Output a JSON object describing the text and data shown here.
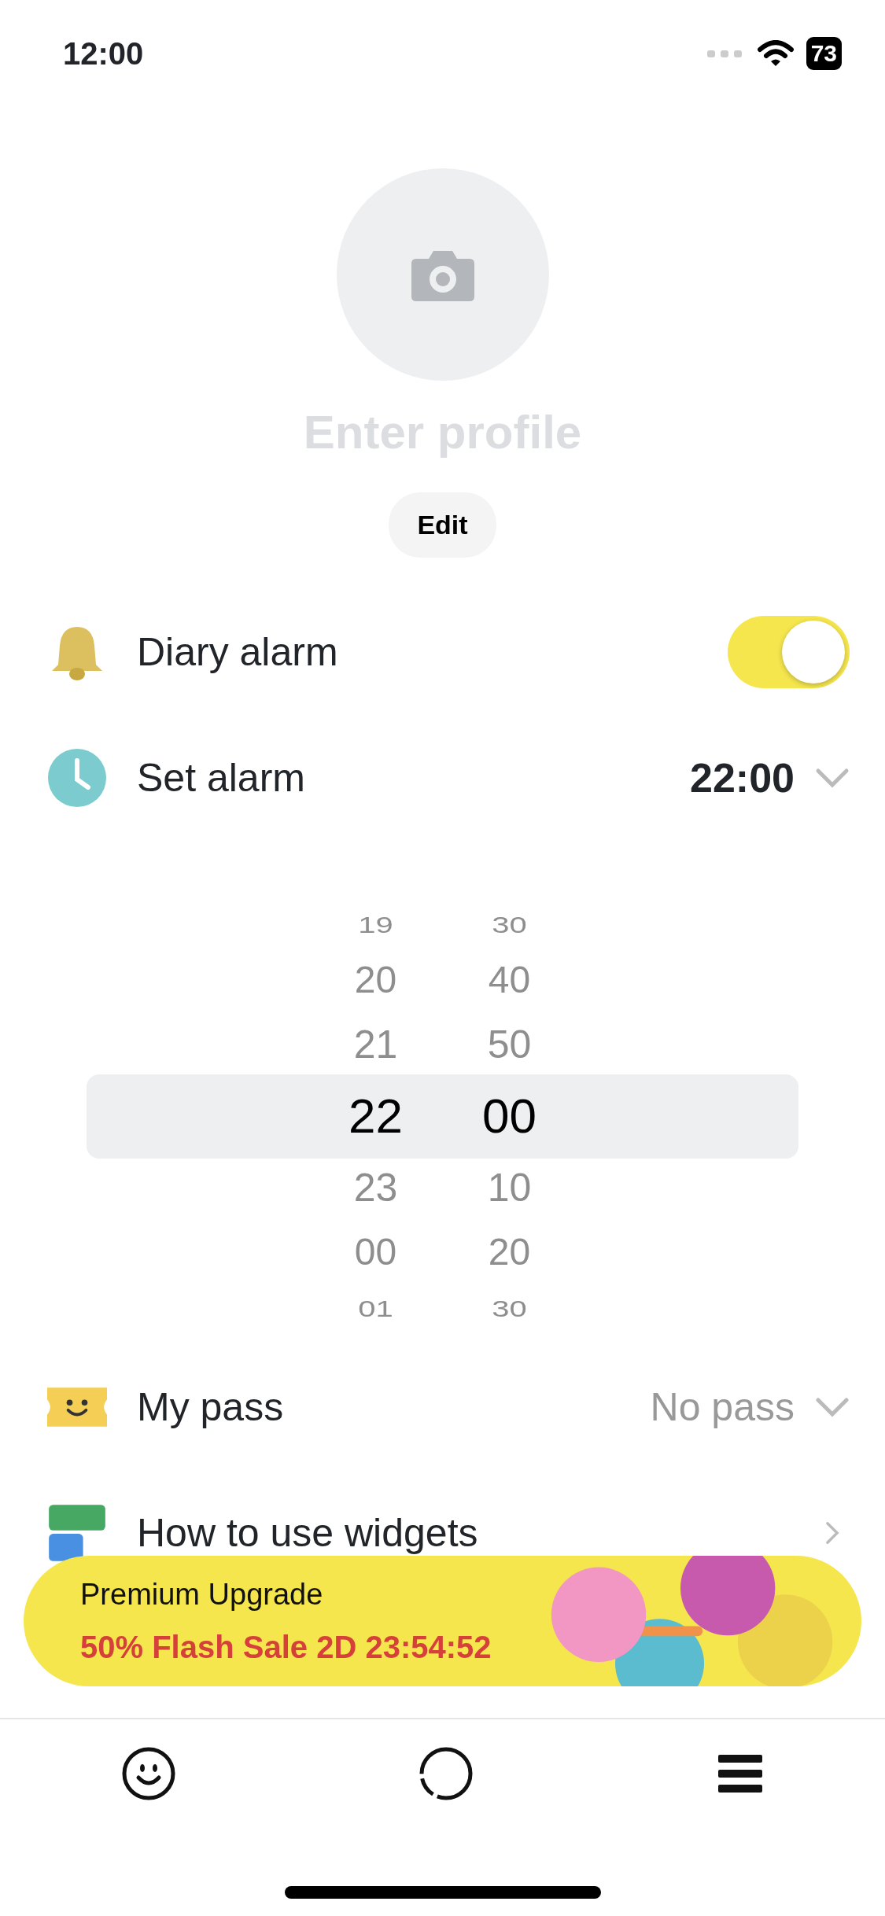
{
  "status_bar": {
    "time": "12:00",
    "battery": "73"
  },
  "profile": {
    "name_placeholder": "Enter profile",
    "edit_button": "Edit"
  },
  "settings": [
    {
      "kind": "toggle",
      "label": "Diary alarm",
      "on": true
    },
    {
      "kind": "value",
      "label": "Set alarm",
      "value": "22:00",
      "emphasis": true
    }
  ],
  "time_picker": {
    "rows": [
      {
        "hour": "19",
        "minute": "30",
        "selected": false
      },
      {
        "hour": "20",
        "minute": "40",
        "selected": false
      },
      {
        "hour": "21",
        "minute": "50",
        "selected": false
      },
      {
        "hour": "22",
        "minute": "00",
        "selected": true
      },
      {
        "hour": "23",
        "minute": "10",
        "selected": false
      },
      {
        "hour": "00",
        "minute": "20",
        "selected": false
      },
      {
        "hour": "01",
        "minute": "30",
        "selected": false
      }
    ]
  },
  "menu": [
    {
      "kind": "pass",
      "label": "My pass",
      "value": "No pass"
    },
    {
      "kind": "widgets",
      "label": "How to use widgets"
    }
  ],
  "banner": {
    "title": "Premium Upgrade",
    "subtitle": "50% Flash Sale 2D 23:54:52"
  },
  "tab_bar": [
    {
      "kind": "face",
      "selected": false
    },
    {
      "kind": "ring",
      "selected": false
    },
    {
      "kind": "menu",
      "selected": false
    }
  ]
}
